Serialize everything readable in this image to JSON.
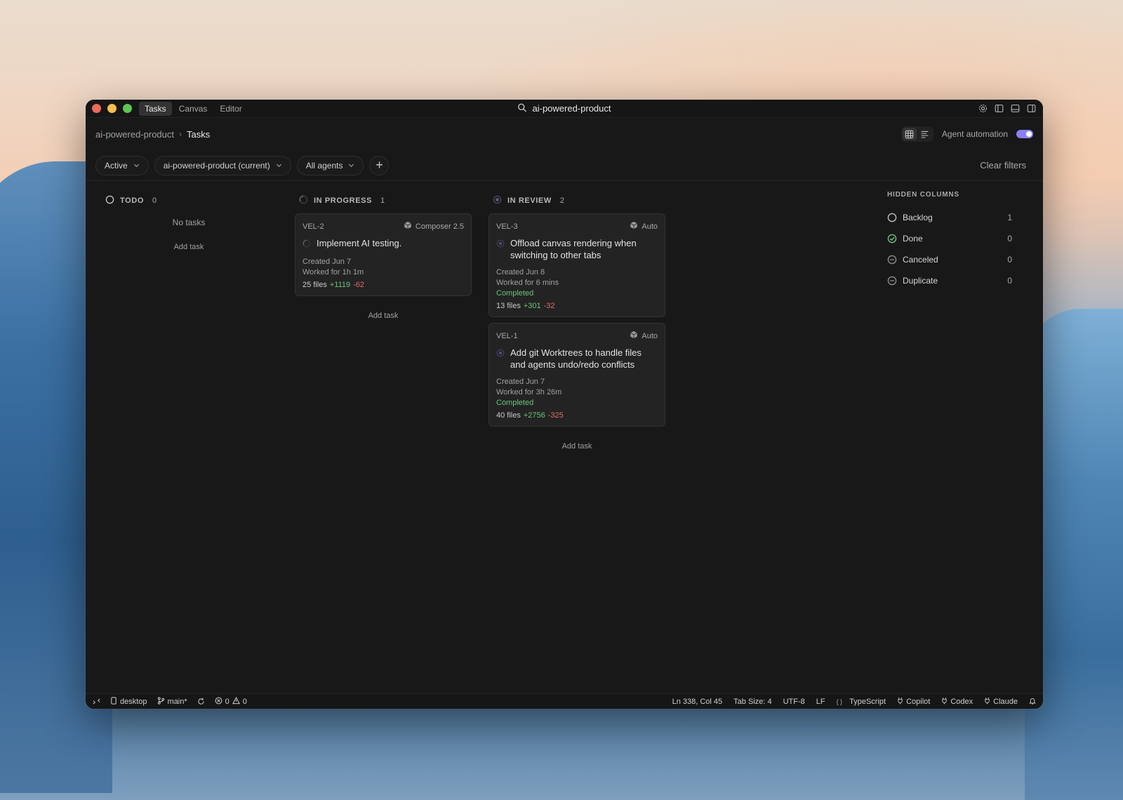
{
  "window": {
    "tabs": [
      {
        "label": "Tasks",
        "active": true
      },
      {
        "label": "Canvas",
        "active": false
      },
      {
        "label": "Editor",
        "active": false
      }
    ],
    "search_title": "ai-powered-product"
  },
  "header": {
    "breadcrumb_project": "ai-powered-product",
    "breadcrumb_separator": "›",
    "breadcrumb_current": "Tasks",
    "automation_label": "Agent automation",
    "automation_on": true
  },
  "filters": {
    "status": "Active",
    "project": "ai-powered-product (current)",
    "agents": "All agents",
    "add_label": "+",
    "clear_label": "Clear filters"
  },
  "columns": {
    "todo": {
      "title": "TODO",
      "count": "0",
      "empty_text": "No tasks",
      "add_label": "Add task"
    },
    "in_progress": {
      "title": "IN PROGRESS",
      "count": "1",
      "add_label": "Add task",
      "cards": [
        {
          "id": "VEL-2",
          "agent": "Composer 2.5",
          "title": "Implement AI testing.",
          "created": "Created Jun 7",
          "worked": "Worked for 1h 1m",
          "files": "25 files",
          "added": "+1119",
          "removed": "-62"
        }
      ]
    },
    "in_review": {
      "title": "IN REVIEW",
      "count": "2",
      "add_label": "Add task",
      "cards": [
        {
          "id": "VEL-3",
          "agent": "Auto",
          "title": "Offload canvas rendering when switching to other tabs",
          "created": "Created Jun 8",
          "worked": "Worked for 6 mins",
          "status": "Completed",
          "files": "13 files",
          "added": "+301",
          "removed": "-32"
        },
        {
          "id": "VEL-1",
          "agent": "Auto",
          "title": "Add git Worktrees to handle files and agents undo/redo conflicts",
          "created": "Created Jun 7",
          "worked": "Worked for 3h 26m",
          "status": "Completed",
          "files": "40 files",
          "added": "+2756",
          "removed": "-325"
        }
      ]
    }
  },
  "hidden_columns": {
    "title": "HIDDEN COLUMNS",
    "items": [
      {
        "label": "Backlog",
        "count": "1",
        "icon": "empty-circle-icon"
      },
      {
        "label": "Done",
        "count": "0",
        "icon": "check-circle-icon"
      },
      {
        "label": "Canceled",
        "count": "0",
        "icon": "minus-circle-icon"
      },
      {
        "label": "Duplicate",
        "count": "0",
        "icon": "minus-circle-icon"
      }
    ]
  },
  "statusbar": {
    "device": "desktop",
    "branch": "main*",
    "errors": "0",
    "warnings": "0",
    "position": "Ln 338, Col 45",
    "tab_size": "Tab Size: 4",
    "encoding": "UTF-8",
    "eol": "LF",
    "braces": "{ }",
    "language": "TypeScript",
    "copilot": "Copilot",
    "codex": "Codex",
    "claude": "Claude"
  },
  "colors": {
    "accent": "#8b7ff2",
    "added": "#6cc47a",
    "removed": "#e36a6a",
    "window_bg": "#181818"
  }
}
